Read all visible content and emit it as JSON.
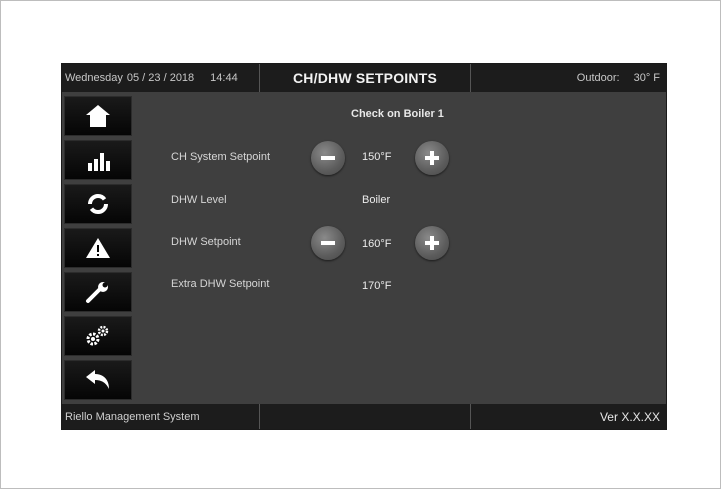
{
  "header": {
    "day": "Wednesday",
    "date": "05 / 23 / 2018",
    "time": "14:44",
    "title": "CH/DHW SETPOINTS",
    "outdoor_label": "Outdoor:",
    "outdoor_value": "30° F"
  },
  "sidebar": {
    "items": [
      {
        "icon": "home-icon"
      },
      {
        "icon": "bar-chart-icon"
      },
      {
        "icon": "cycle-icon"
      },
      {
        "icon": "warning-icon"
      },
      {
        "icon": "wrench-icon"
      },
      {
        "icon": "gears-icon"
      },
      {
        "icon": "back-arrow-icon"
      }
    ]
  },
  "main": {
    "check_title": "Check on Boiler 1",
    "rows": [
      {
        "label": "CH System Setpoint",
        "value": "150°F"
      },
      {
        "label": "DHW Level",
        "value": "Boiler"
      },
      {
        "label": "DHW Setpoint",
        "value": "160°F"
      },
      {
        "label": "Extra DHW Setpoint",
        "value": "170°F"
      }
    ]
  },
  "footer": {
    "system_name": "Riello Management System",
    "middle": "",
    "version": "Ver X.X.XX"
  },
  "colors": {
    "screen_bg": "#3f3f3f",
    "bar_bg": "#1c1c1c",
    "button_bg": "#0a0a0a",
    "round_button": "#6a6a6a"
  }
}
